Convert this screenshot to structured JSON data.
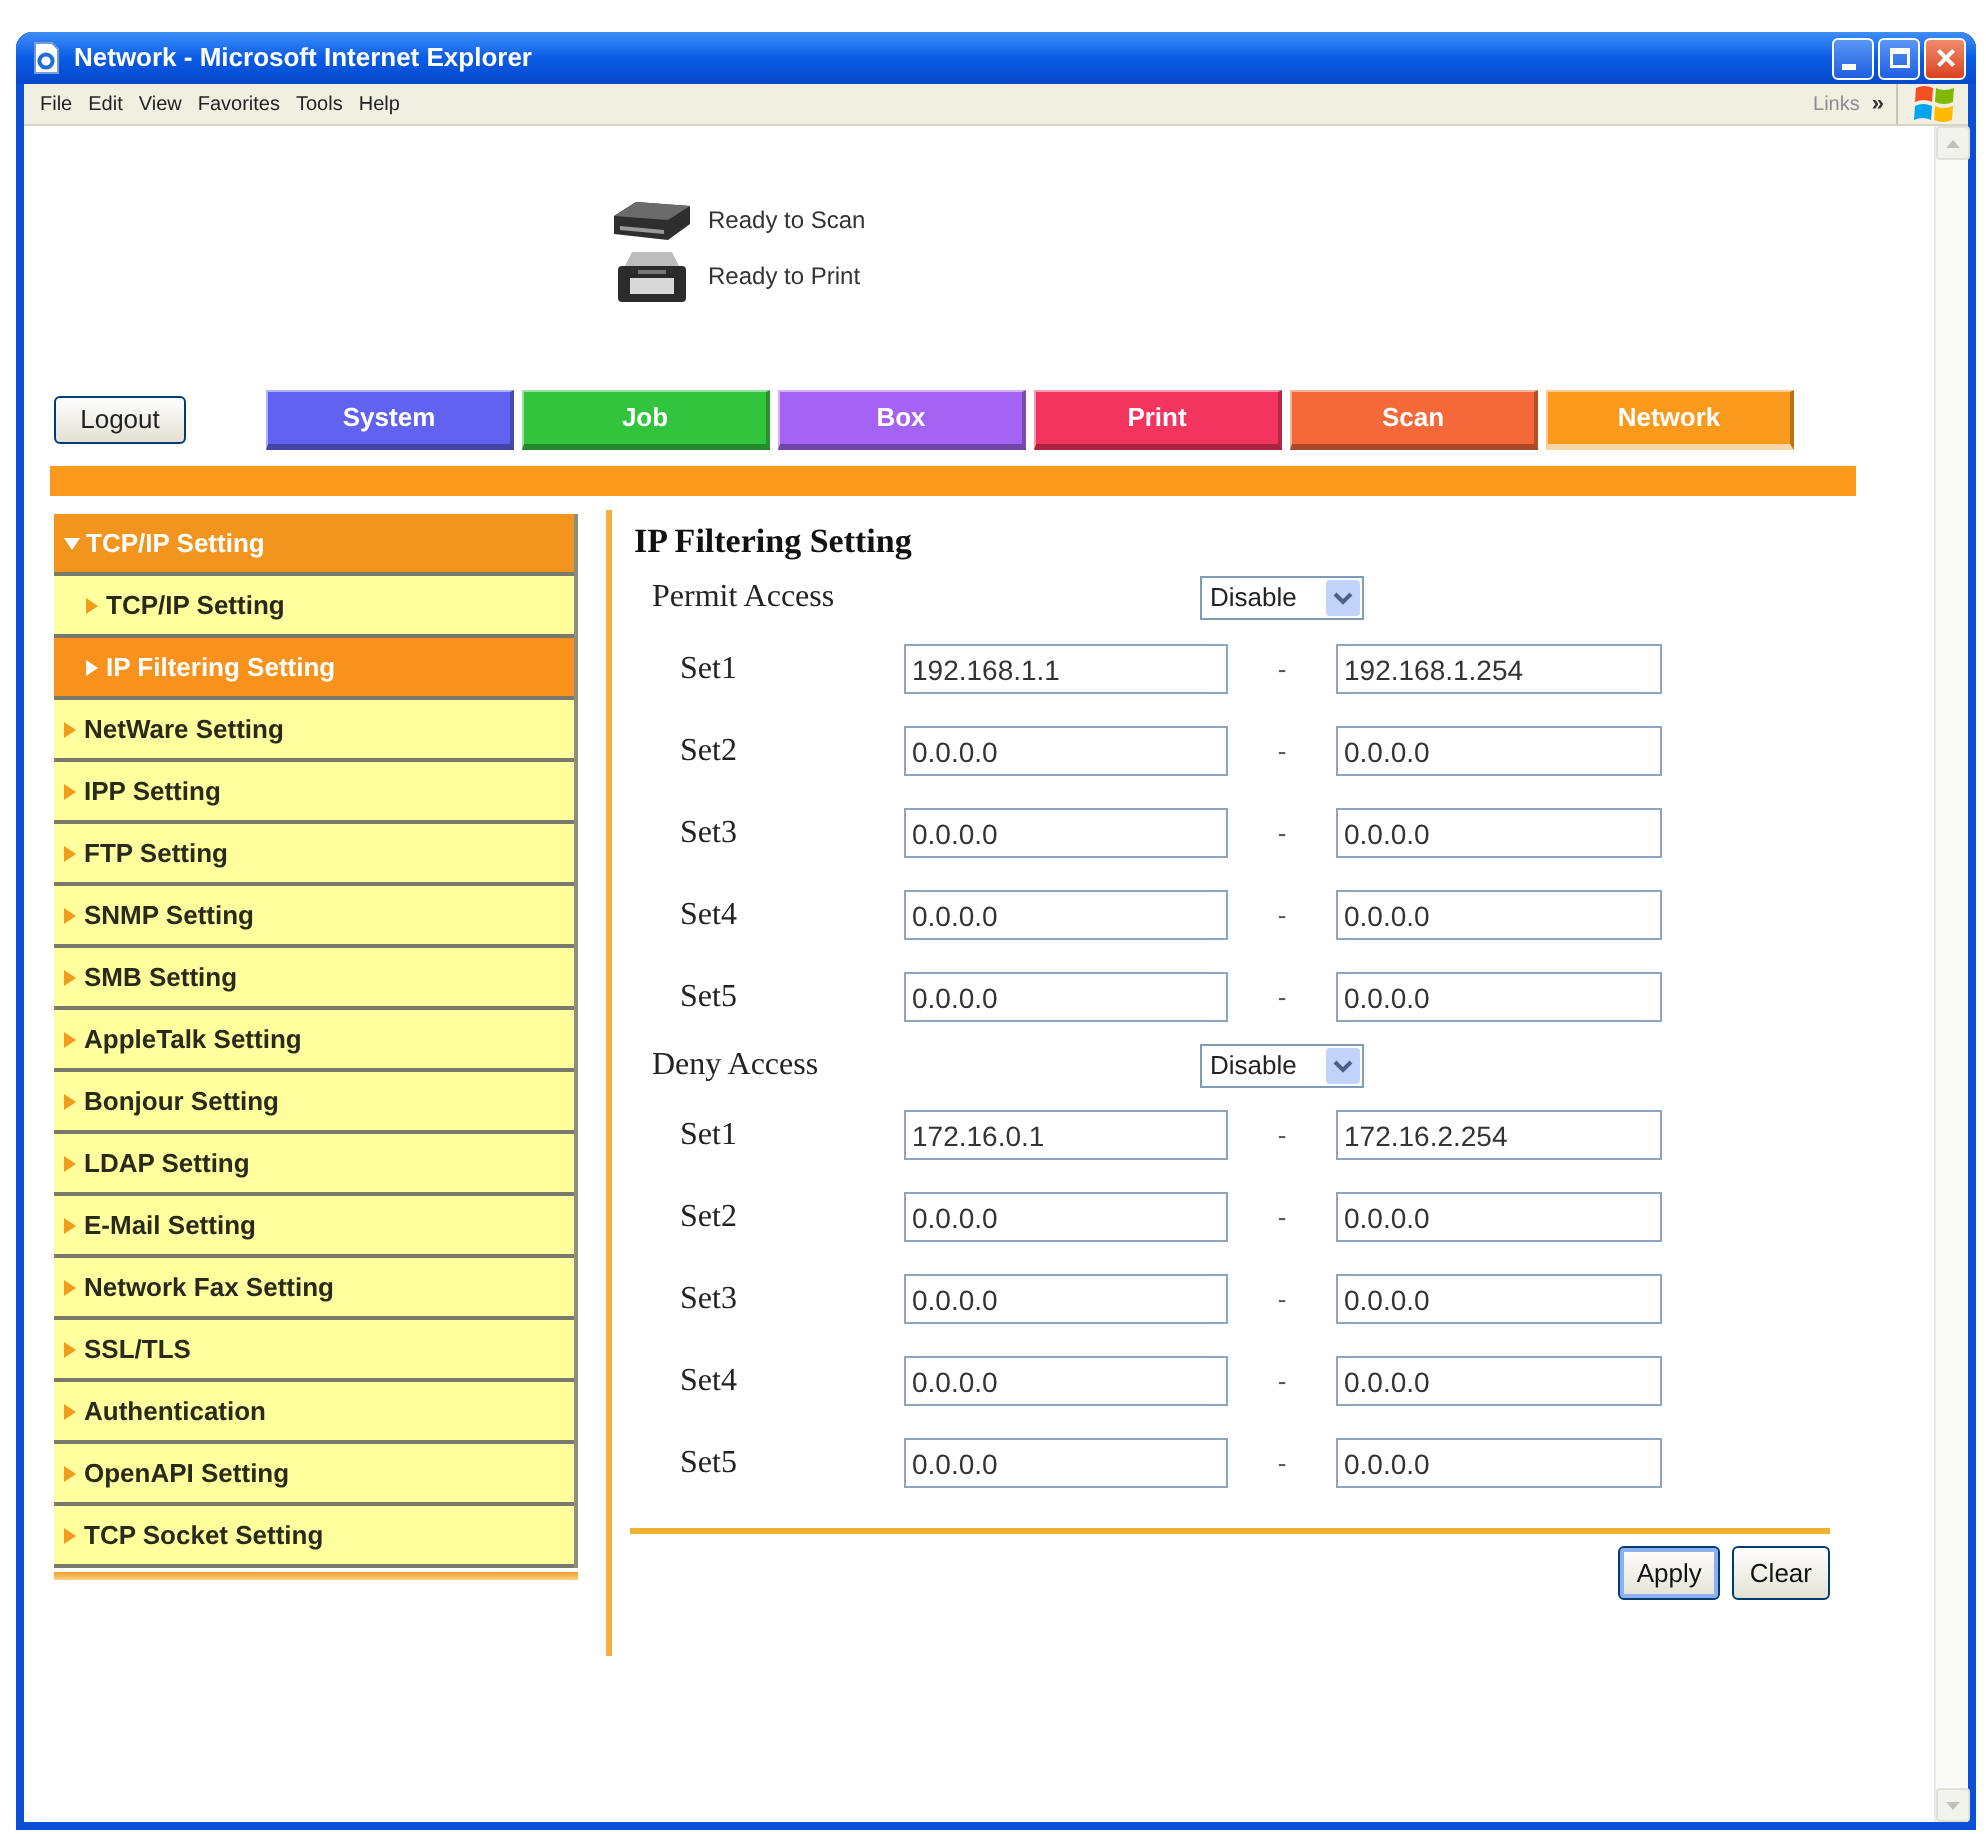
{
  "window": {
    "title": "Network - Microsoft Internet Explorer"
  },
  "menu_bar": {
    "items": [
      "File",
      "Edit",
      "View",
      "Favorites",
      "Tools",
      "Help"
    ],
    "links_label": "Links",
    "links_chevron": "»"
  },
  "device_status": [
    {
      "kind": "scanner",
      "text": "Ready to Scan"
    },
    {
      "kind": "printer",
      "text": "Ready to Print"
    }
  ],
  "logout_button": "Logout",
  "tabs": [
    {
      "label": "System",
      "color": "#6262f0",
      "selected": false
    },
    {
      "label": "Job",
      "color": "#33c43d",
      "selected": false
    },
    {
      "label": "Box",
      "color": "#a463f2",
      "selected": false
    },
    {
      "label": "Print",
      "color": "#f2345f",
      "selected": false
    },
    {
      "label": "Scan",
      "color": "#f4683a",
      "selected": false
    },
    {
      "label": "Network",
      "color": "#f99a1c",
      "selected": true
    }
  ],
  "sidebar": {
    "items": [
      {
        "label": "TCP/IP Setting",
        "expanded": true,
        "selected": false,
        "children": [
          {
            "label": "TCP/IP Setting",
            "selected": false
          },
          {
            "label": "IP Filtering Setting",
            "selected": true
          }
        ]
      },
      {
        "label": "NetWare Setting",
        "expanded": false,
        "selected": false
      },
      {
        "label": "IPP Setting",
        "expanded": false,
        "selected": false
      },
      {
        "label": "FTP Setting",
        "expanded": false,
        "selected": false
      },
      {
        "label": "SNMP Setting",
        "expanded": false,
        "selected": false
      },
      {
        "label": "SMB Setting",
        "expanded": false,
        "selected": false
      },
      {
        "label": "AppleTalk Setting",
        "expanded": false,
        "selected": false
      },
      {
        "label": "Bonjour Setting",
        "expanded": false,
        "selected": false
      },
      {
        "label": "LDAP Setting",
        "expanded": false,
        "selected": false
      },
      {
        "label": "E-Mail Setting",
        "expanded": false,
        "selected": false
      },
      {
        "label": "Network Fax Setting",
        "expanded": false,
        "selected": false
      },
      {
        "label": "SSL/TLS",
        "expanded": false,
        "selected": false
      },
      {
        "label": "Authentication",
        "expanded": false,
        "selected": false
      },
      {
        "label": "OpenAPI Setting",
        "expanded": false,
        "selected": false
      },
      {
        "label": "TCP Socket Setting",
        "expanded": false,
        "selected": false
      }
    ]
  },
  "form": {
    "title": "IP Filtering Setting",
    "groups": [
      {
        "label": "Permit Access",
        "mode": "Disable",
        "sets": [
          {
            "label": "Set1",
            "from": "192.168.1.1",
            "dash": "-",
            "to": "192.168.1.254"
          },
          {
            "label": "Set2",
            "from": "0.0.0.0",
            "dash": "-",
            "to": "0.0.0.0"
          },
          {
            "label": "Set3",
            "from": "0.0.0.0",
            "dash": "-",
            "to": "0.0.0.0"
          },
          {
            "label": "Set4",
            "from": "0.0.0.0",
            "dash": "-",
            "to": "0.0.0.0"
          },
          {
            "label": "Set5",
            "from": "0.0.0.0",
            "dash": "-",
            "to": "0.0.0.0"
          }
        ]
      },
      {
        "label": "Deny Access",
        "mode": "Disable",
        "sets": [
          {
            "label": "Set1",
            "from": "172.16.0.1",
            "dash": "-",
            "to": "172.16.2.254"
          },
          {
            "label": "Set2",
            "from": "0.0.0.0",
            "dash": "-",
            "to": "0.0.0.0"
          },
          {
            "label": "Set3",
            "from": "0.0.0.0",
            "dash": "-",
            "to": "0.0.0.0"
          },
          {
            "label": "Set4",
            "from": "0.0.0.0",
            "dash": "-",
            "to": "0.0.0.0"
          },
          {
            "label": "Set5",
            "from": "0.0.0.0",
            "dash": "-",
            "to": "0.0.0.0"
          }
        ]
      }
    ]
  },
  "buttons": [
    {
      "label": "Apply",
      "default": true
    },
    {
      "label": "Clear",
      "default": false
    }
  ]
}
